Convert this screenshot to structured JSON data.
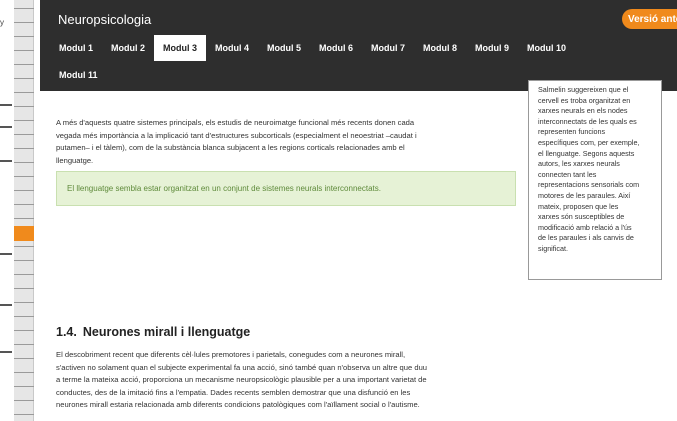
{
  "header": {
    "site_title": "Neuropsicologia",
    "prev_version_label": "Versió anterior",
    "nav_tabs": [
      "Modul 1",
      "Modul 2",
      "Modul 3",
      "Modul 4",
      "Modul 5",
      "Modul 6",
      "Modul 7",
      "Modul 8",
      "Modul 9",
      "Modul 10",
      "Modul 11"
    ],
    "active_tab": "Modul 3",
    "brand_color": "#f08a1c",
    "bar_color": "#2e2e2e"
  },
  "main": {
    "para1_lines": [
      "A més d'aquests quatre sistemes principals, els estudis de neuroimatge funcional més recents donen cada",
      "vegada més importància a la implicació tant d'estructures subcorticals (especialment el neoestriat –caudat i",
      "putamen– i el tàlem), com de la substància blanca subjacent a les regions corticals relacionades amb el",
      "llenguatge."
    ],
    "highlight": "El llenguatge sembla estar organitzat en un conjunt de sistemes neurals interconnectats.",
    "section_number": "1.4.",
    "section_title": "Neurones mirall i llenguatge",
    "para2_lines": [
      "El descobriment recent que diferents cèl·lules premotores i parietals, conegudes com a neurones mirall,",
      "s'activen no solament quan el subjecte experimental fa una acció, sinó també quan n'observa un altre que duu",
      "a terme la mateixa acció, proporciona un mecanisme neuropsicològic plausible per a una important varietat de",
      "conductes, des de la imitació fins a l'empatia. Dades recents semblen demostrar que una disfunció en les",
      "neurones mirall estaria relacionada amb diferents condicions patològiques com l'aïllament social o l'autisme."
    ]
  },
  "sidebox": {
    "lines": [
      "Salmelin suggereixen que el",
      "cervell es troba organitzat en",
      "xarxes neurals en els nodes",
      "interconnectats de les quals es",
      "representen funcions",
      "específiques com, per exemple,",
      "el llenguatge. Segons aquests",
      "autors, les xarxes neurals",
      "connecten tant les",
      "representacions sensorials com",
      "motores de les paraules. Així",
      "mateix, proposen que les",
      "xarxes són susceptibles de",
      "modificació amb relació a l'ús",
      "de les paraules i als canvis de",
      "significat."
    ]
  },
  "left": {
    "label": "y"
  }
}
